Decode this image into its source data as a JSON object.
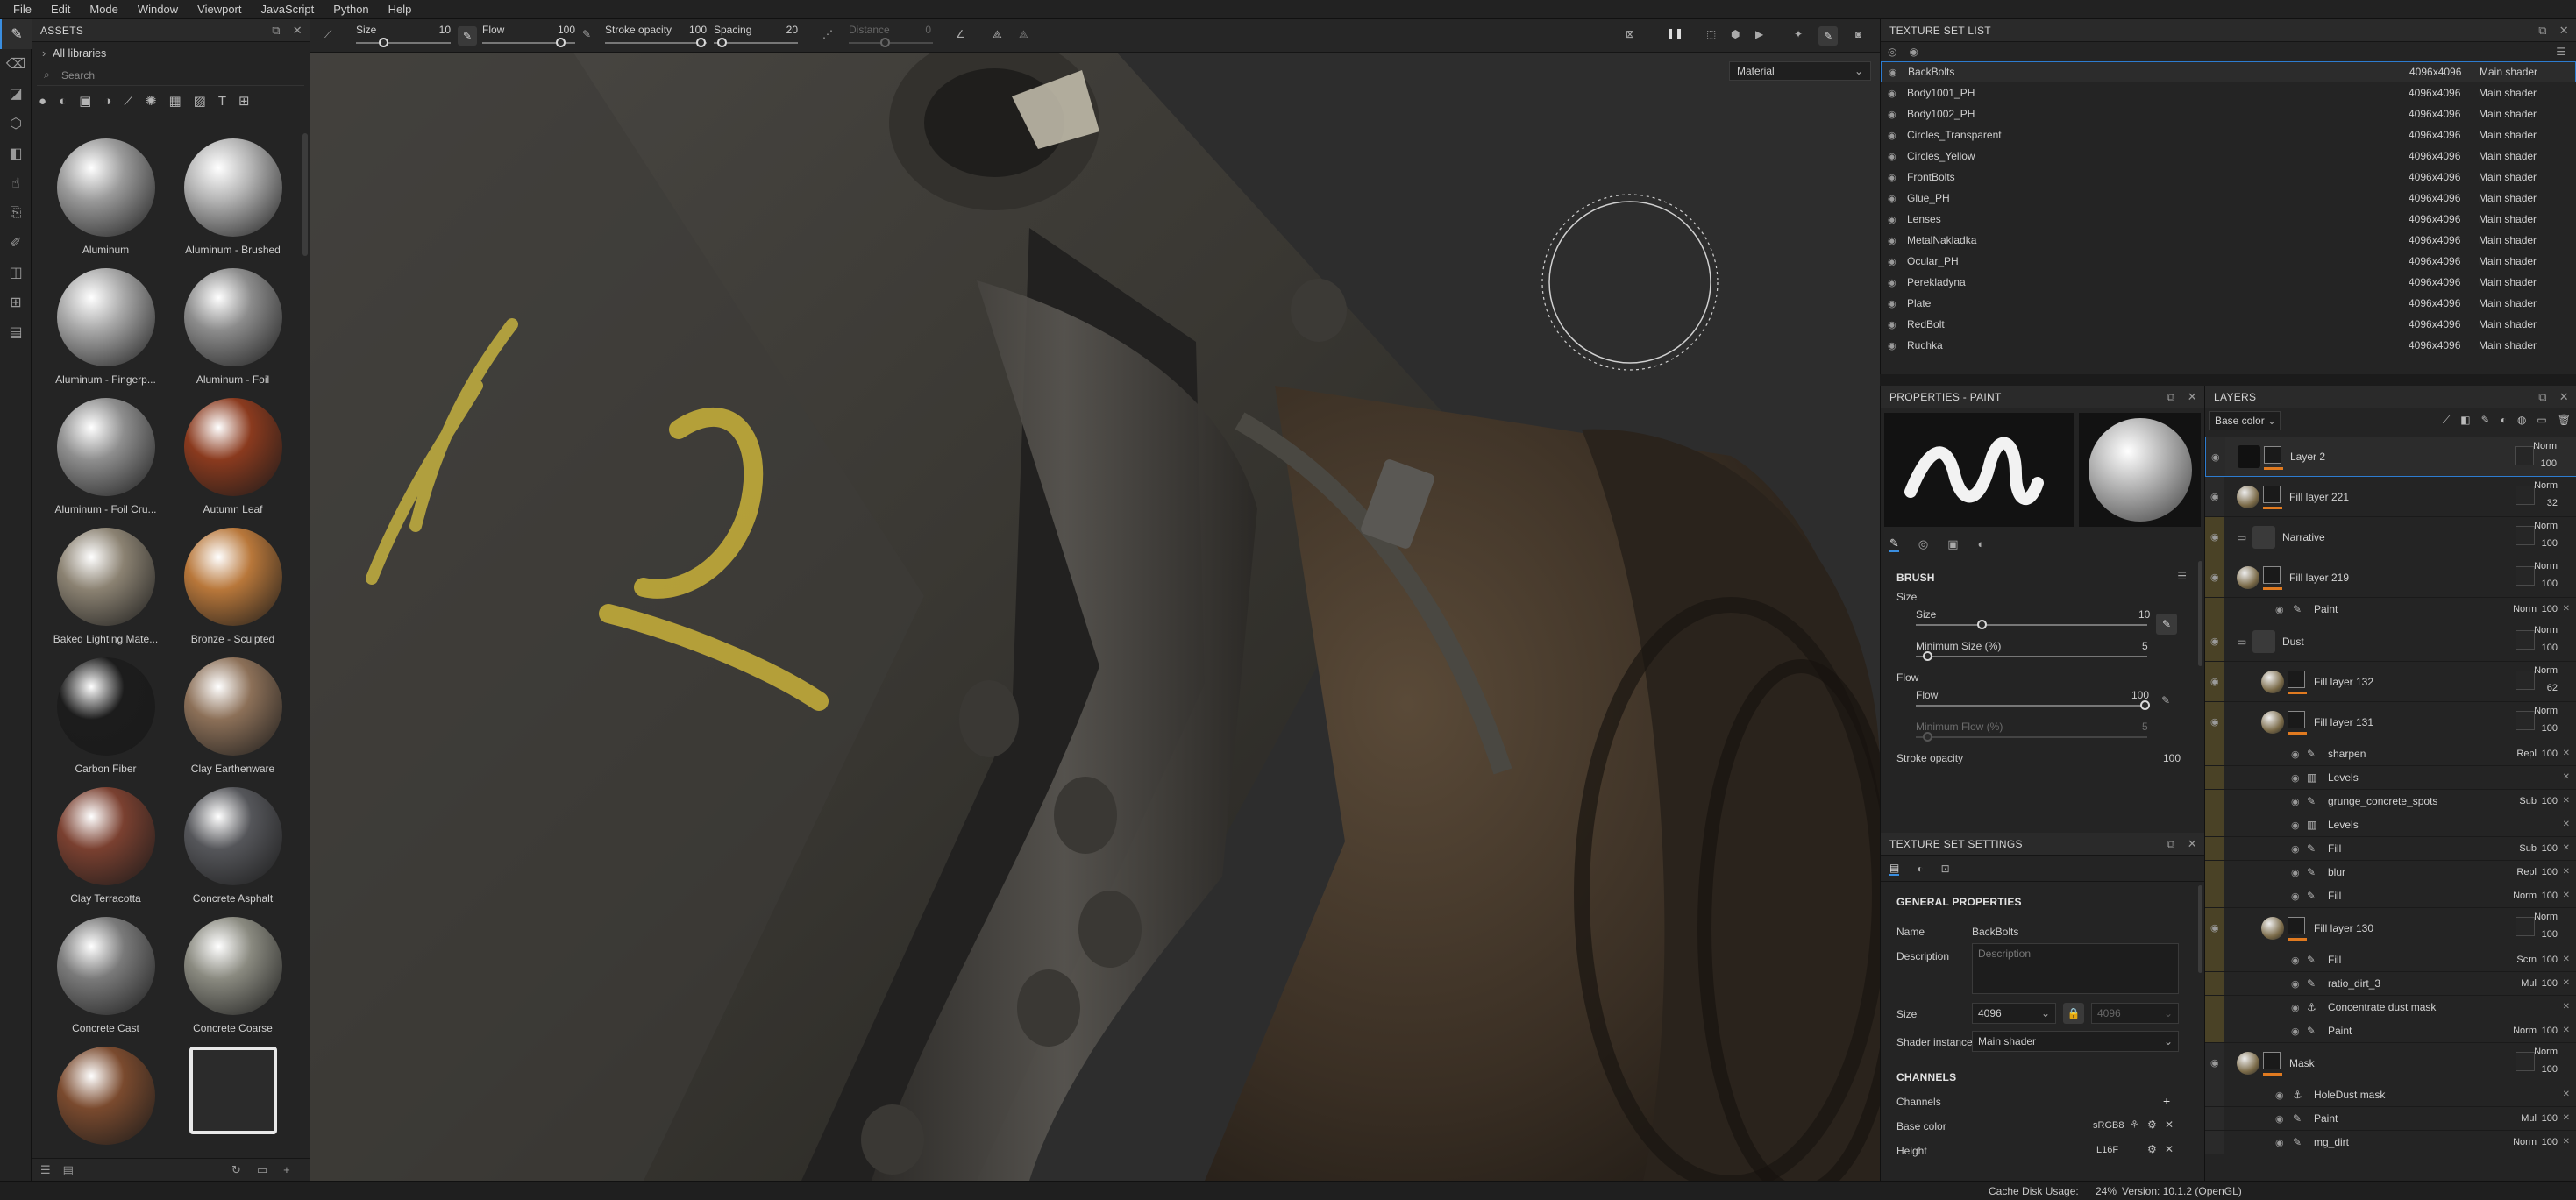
{
  "menu": [
    "File",
    "Edit",
    "Mode",
    "Window",
    "Viewport",
    "JavaScript",
    "Python",
    "Help"
  ],
  "assets": {
    "title": "ASSETS",
    "library": "All libraries",
    "search_placeholder": "Search",
    "items": [
      "Aluminum",
      "Aluminum - Brushed",
      "Aluminum - Fingerp...",
      "Aluminum - Foil",
      "Aluminum - Foil Cru...",
      "Autumn Leaf",
      "Baked Lighting Mate...",
      "Bronze - Sculpted",
      "Carbon Fiber",
      "Clay Earthenware",
      "Clay Terracotta",
      "Concrete Asphalt",
      "Concrete Cast",
      "Concrete Coarse",
      "",
      ""
    ],
    "colors": [
      "#9a9a9a",
      "#b4b4b4",
      "#a8a8a8",
      "#8c8c8c",
      "#8e8e8e",
      "#8a3a1e",
      "#8b8272",
      "#b8773a",
      "#1c1c1c",
      "#8c7058",
      "#7a4030",
      "#55565a",
      "#7a7a7a",
      "#8a8a80",
      "#7a4a2e",
      "#e8e8e8"
    ]
  },
  "toolbar": {
    "size_label": "Size",
    "size_value": "10",
    "flow_label": "Flow",
    "flow_value": "100",
    "stroke_label": "Stroke opacity",
    "stroke_value": "100",
    "spacing_label": "Spacing",
    "spacing_value": "20",
    "distance_label": "Distance",
    "distance_value": "0"
  },
  "viewport": {
    "material_mode": "Material"
  },
  "texture_set_list": {
    "title": "TEXTURE SET LIST",
    "rows": [
      {
        "name": "BackBolts",
        "res": "4096x4096",
        "shader": "Main shader"
      },
      {
        "name": "Body1001_PH",
        "res": "4096x4096",
        "shader": "Main shader"
      },
      {
        "name": "Body1002_PH",
        "res": "4096x4096",
        "shader": "Main shader"
      },
      {
        "name": "Circles_Transparent",
        "res": "4096x4096",
        "shader": "Main shader"
      },
      {
        "name": "Circles_Yellow",
        "res": "4096x4096",
        "shader": "Main shader"
      },
      {
        "name": "FrontBolts",
        "res": "4096x4096",
        "shader": "Main shader"
      },
      {
        "name": "Glue_PH",
        "res": "4096x4096",
        "shader": "Main shader"
      },
      {
        "name": "Lenses",
        "res": "4096x4096",
        "shader": "Main shader"
      },
      {
        "name": "MetalNakladka",
        "res": "4096x4096",
        "shader": "Main shader"
      },
      {
        "name": "Ocular_PH",
        "res": "4096x4096",
        "shader": "Main shader"
      },
      {
        "name": "Perekladyna",
        "res": "4096x4096",
        "shader": "Main shader"
      },
      {
        "name": "Plate",
        "res": "4096x4096",
        "shader": "Main shader"
      },
      {
        "name": "RedBolt",
        "res": "4096x4096",
        "shader": "Main shader"
      },
      {
        "name": "Ruchka",
        "res": "4096x4096",
        "shader": "Main shader"
      }
    ]
  },
  "properties": {
    "title": "PROPERTIES - PAINT",
    "brush_section": "BRUSH",
    "size_group": "Size",
    "size_label": "Size",
    "size_value": "10",
    "min_size_label": "Minimum Size (%)",
    "min_size_value": "5",
    "flow_group": "Flow",
    "flow_label": "Flow",
    "flow_value": "100",
    "min_flow_label": "Minimum Flow (%)",
    "min_flow_value": "5",
    "stroke_label": "Stroke opacity",
    "stroke_value": "100"
  },
  "texture_set_settings": {
    "title": "TEXTURE SET SETTINGS",
    "general": "GENERAL PROPERTIES",
    "name_label": "Name",
    "name_value": "BackBolts",
    "desc_label": "Description",
    "desc_placeholder": "Description",
    "size_label": "Size",
    "size_value": "4096",
    "size_value2": "4096",
    "shader_label": "Shader instance",
    "shader_value": "Main shader",
    "channels_section": "CHANNELS",
    "channels_label": "Channels",
    "base_color_label": "Base color",
    "base_color_format": "sRGB8",
    "height_label": "Height",
    "height_format": "L16F"
  },
  "layers": {
    "title": "LAYERS",
    "channel": "Base color",
    "rows": [
      {
        "name": "Layer 2",
        "blend": "Norm",
        "opacity": "100",
        "kind": "layer",
        "indent": 0
      },
      {
        "name": "Fill layer 221",
        "blend": "Norm",
        "opacity": "32",
        "kind": "layer",
        "indent": 0
      },
      {
        "name": "Narrative",
        "blend": "Norm",
        "opacity": "100",
        "kind": "folder",
        "indent": 0
      },
      {
        "name": "Fill layer 219",
        "blend": "Norm",
        "opacity": "100",
        "kind": "layer",
        "indent": 0
      },
      {
        "name": "Paint",
        "blend": "Norm",
        "opacity": "100",
        "kind": "effect",
        "indent": 1
      },
      {
        "name": "Dust",
        "blend": "Norm",
        "opacity": "100",
        "kind": "folder",
        "indent": 0
      },
      {
        "name": "Fill layer 132",
        "blend": "Norm",
        "opacity": "62",
        "kind": "layer",
        "indent": 1
      },
      {
        "name": "Fill layer 131",
        "blend": "Norm",
        "opacity": "100",
        "kind": "layer",
        "indent": 1
      },
      {
        "name": "sharpen",
        "blend": "Repl",
        "opacity": "100",
        "kind": "effect",
        "indent": 2
      },
      {
        "name": "Levels",
        "blend": "",
        "opacity": "",
        "kind": "effect",
        "indent": 2
      },
      {
        "name": "grunge_concrete_spots",
        "blend": "Sub",
        "opacity": "100",
        "kind": "effect",
        "indent": 2
      },
      {
        "name": "Levels",
        "blend": "",
        "opacity": "",
        "kind": "effect",
        "indent": 2
      },
      {
        "name": "Fill",
        "blend": "Sub",
        "opacity": "100",
        "kind": "effect",
        "indent": 2
      },
      {
        "name": "blur",
        "blend": "Repl",
        "opacity": "100",
        "kind": "effect",
        "indent": 2
      },
      {
        "name": "Fill",
        "blend": "Norm",
        "opacity": "100",
        "kind": "effect",
        "indent": 2
      },
      {
        "name": "Fill layer 130",
        "blend": "Norm",
        "opacity": "100",
        "kind": "layer",
        "indent": 1
      },
      {
        "name": "Fill",
        "blend": "Scrn",
        "opacity": "100",
        "kind": "effect",
        "indent": 2
      },
      {
        "name": "ratio_dirt_3",
        "blend": "Mul",
        "opacity": "100",
        "kind": "effect",
        "indent": 2
      },
      {
        "name": "Concentrate dust mask",
        "blend": "",
        "opacity": "",
        "kind": "effect",
        "indent": 2
      },
      {
        "name": "Paint",
        "blend": "Norm",
        "opacity": "100",
        "kind": "effect",
        "indent": 2
      },
      {
        "name": "Mask",
        "blend": "Norm",
        "opacity": "100",
        "kind": "layer",
        "indent": 0
      },
      {
        "name": "HoleDust mask",
        "blend": "",
        "opacity": "",
        "kind": "effect",
        "indent": 1
      },
      {
        "name": "Paint",
        "blend": "Mul",
        "opacity": "100",
        "kind": "effect",
        "indent": 1
      },
      {
        "name": "mg_dirt",
        "blend": "Norm",
        "opacity": "100",
        "kind": "effect",
        "indent": 1
      }
    ]
  },
  "status": {
    "cache": "Cache Disk Usage:",
    "cache_value": "24%",
    "version": "Version: 10.1.2 (OpenGL)"
  }
}
